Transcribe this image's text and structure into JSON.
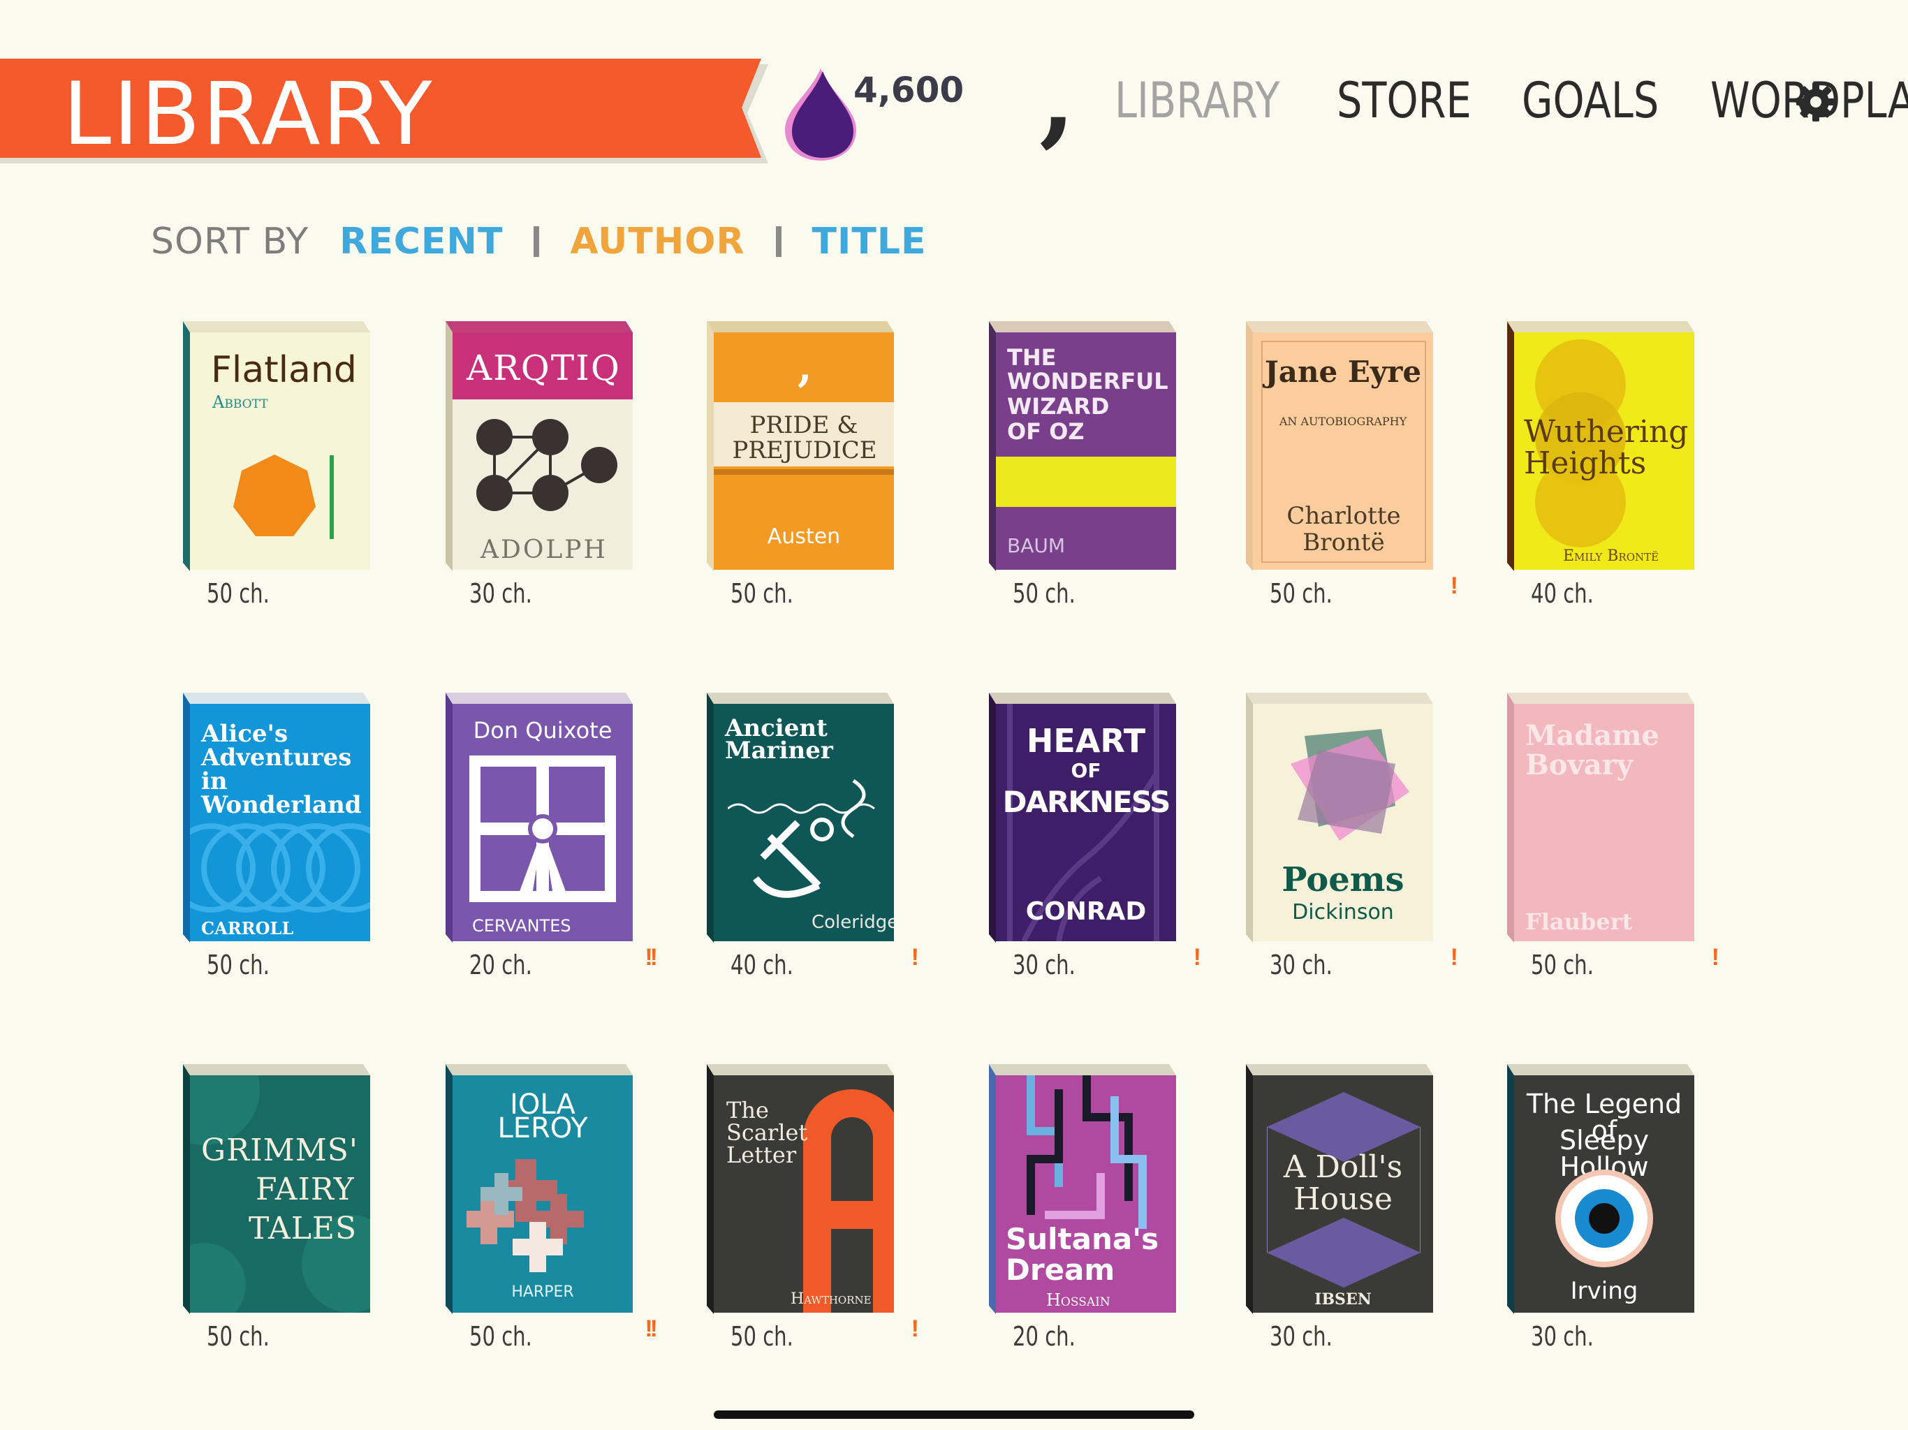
{
  "header": {
    "title": "LIBRARY",
    "ink_count": "4,600",
    "logo": "comma-logo",
    "nav": [
      "LIBRARY",
      "STORE",
      "GOALS",
      "WORDPLAY"
    ],
    "active_nav": "LIBRARY",
    "settings_icon": "gear-icon",
    "colors": {
      "banner": "#f55a2c",
      "ink": "#4a1d7a",
      "ink_outline": "#e98ad0"
    }
  },
  "sort": {
    "label": "SORT BY",
    "options": [
      "RECENT",
      "AUTHOR",
      "TITLE"
    ],
    "colors": {
      "recent": "#3fa8dc",
      "author": "#f0a43c",
      "title": "#3fa8dc"
    }
  },
  "books": [
    {
      "title": "Flatland",
      "author": "Abbott",
      "chapters": "50 ch.",
      "alert": ""
    },
    {
      "title": "ARQTIQ",
      "author": "ADOLPH",
      "chapters": "30 ch.",
      "alert": ""
    },
    {
      "title": "PRIDE & PREJUDICE",
      "author": "Austen",
      "chapters": "50 ch.",
      "alert": ""
    },
    {
      "title": "THE WONDERFUL WIZARD OF OZ",
      "author": "BAUM",
      "chapters": "50 ch.",
      "alert": ""
    },
    {
      "title": "Jane Eyre",
      "subtitle": "AN AUTOBIOGRAPHY",
      "author": "Charlotte Brontë",
      "chapters": "50 ch.",
      "alert": "!"
    },
    {
      "title": "Wuthering Heights",
      "author": "Emily Brontë",
      "chapters": "40 ch.",
      "alert": ""
    },
    {
      "title": "Alice's Adventures in Wonderland",
      "author": "CARROLL",
      "chapters": "50 ch.",
      "alert": ""
    },
    {
      "title": "Don Quixote",
      "author": "CERVANTES",
      "chapters": "20 ch.",
      "alert": "!!"
    },
    {
      "title": "Ancient Mariner",
      "author": "Coleridge",
      "chapters": "40 ch.",
      "alert": "!"
    },
    {
      "title": "HEART OF DARKNESS",
      "author": "CONRAD",
      "chapters": "30 ch.",
      "alert": "!"
    },
    {
      "title": "Poems",
      "author": "Dickinson",
      "chapters": "30 ch.",
      "alert": "!"
    },
    {
      "title": "Madame Bovary",
      "author": "Flaubert",
      "chapters": "50 ch.",
      "alert": "!"
    },
    {
      "title": "GRIMMS' FAIRY TALES",
      "author": "",
      "chapters": "50 ch.",
      "alert": ""
    },
    {
      "title": "IOLA LEROY",
      "author": "HARPER",
      "chapters": "50 ch.",
      "alert": "!!"
    },
    {
      "title": "The Scarlet Letter",
      "author": "Hawthorne",
      "chapters": "50 ch.",
      "alert": "!"
    },
    {
      "title": "Sultana's Dream",
      "author": "Hossain",
      "chapters": "20 ch.",
      "alert": ""
    },
    {
      "title": "A Doll's House",
      "author": "IBSEN",
      "chapters": "30 ch.",
      "alert": ""
    },
    {
      "title": "The Legend of Sleepy Hollow",
      "author": "Irving",
      "chapters": "30 ch.",
      "alert": ""
    }
  ],
  "titles": {
    "b0": [
      "Flatland"
    ],
    "b1": [
      "ARQTIQ"
    ],
    "b2": [
      "PRIDE &",
      "PREJUDICE"
    ],
    "b3": [
      "THE",
      "WONDERFUL",
      "WIZARD",
      "OF OZ"
    ],
    "b4": [
      "Jane Eyre"
    ],
    "b5": [
      "Wuthering",
      "Heights"
    ],
    "b6": [
      "Alice's",
      "Adventures",
      "in",
      "Wonderland"
    ],
    "b7": [
      "Don Quixote"
    ],
    "b8": [
      "Ancient",
      "Mariner"
    ],
    "b9": [
      "HEART",
      "OF",
      "DARKNESS"
    ],
    "b10": [
      "Poems"
    ],
    "b11": [
      "Madame",
      "Bovary"
    ],
    "b12": [
      "GRIMMS'",
      "FAIRY",
      "TALES"
    ],
    "b13": [
      "IOLA",
      "LEROY"
    ],
    "b14": [
      "The",
      "Scarlet",
      "Letter"
    ],
    "b15": [
      "Sultana's",
      "Dream"
    ],
    "b16": [
      "A Doll's",
      "House"
    ],
    "b17": [
      "The Legend of",
      "Sleepy Hollow"
    ]
  }
}
